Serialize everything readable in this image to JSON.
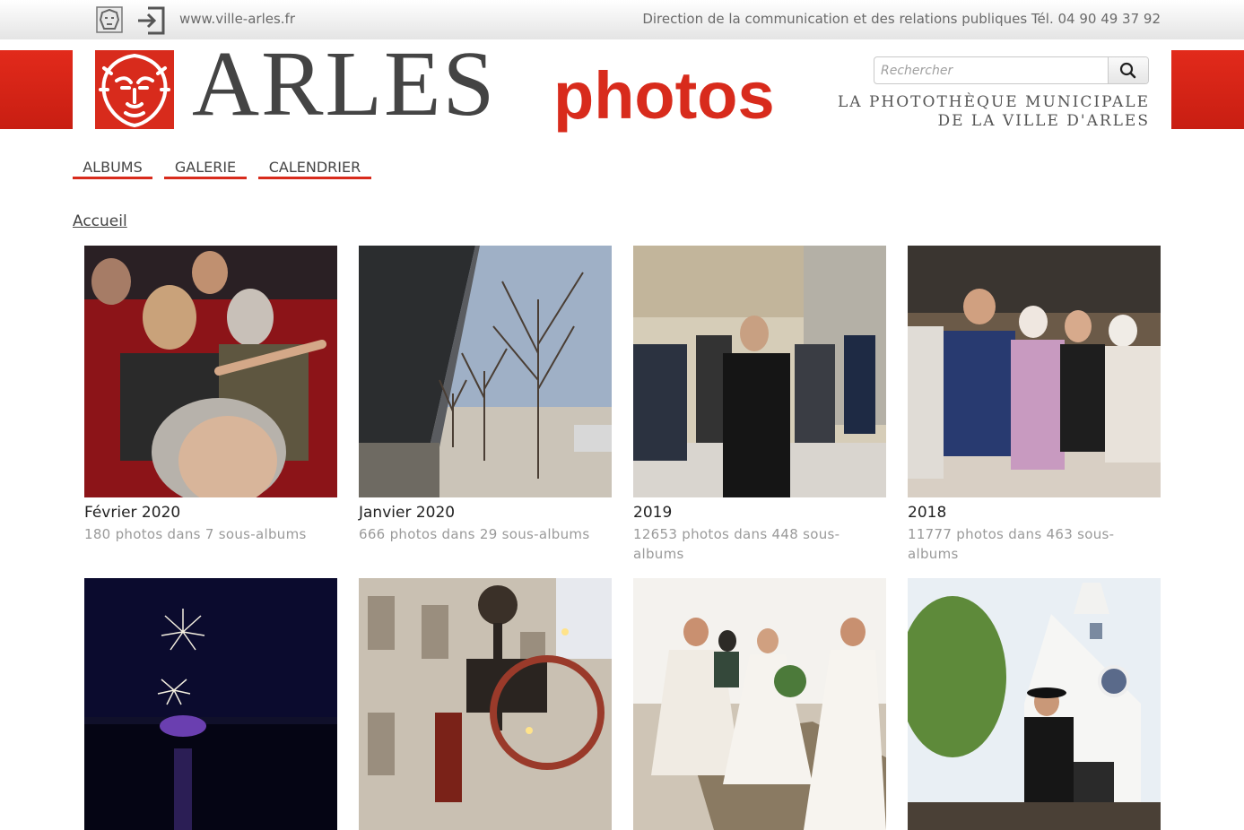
{
  "topbar": {
    "url": "www.ville-arles.fr",
    "contact": "Direction de la communication et des relations publiques Tél. 04 90 49 37 92",
    "icons": [
      "lion-emblem-icon",
      "login-icon"
    ]
  },
  "header": {
    "logo_main": "ARLES",
    "logo_sub": "photos",
    "search_placeholder": "Rechercher",
    "tagline_line1": "LA PHOTOTHÈQUE MUNICIPALE",
    "tagline_line2": "DE LA VILLE D'ARLES"
  },
  "nav": {
    "items": [
      {
        "label": "ALBUMS"
      },
      {
        "label": "GALERIE"
      },
      {
        "label": "CALENDRIER"
      }
    ]
  },
  "breadcrumb": "Accueil",
  "albums": [
    {
      "title": "Février 2020",
      "count": "180 photos dans 7 sous-albums"
    },
    {
      "title": "Janvier 2020",
      "count": "666 photos dans 29 sous-albums"
    },
    {
      "title": "2019",
      "count": "12653 photos dans 448 sous-albums"
    },
    {
      "title": "2018",
      "count": "11777 photos dans 463 sous-albums"
    },
    {
      "title": "",
      "count": ""
    },
    {
      "title": "",
      "count": ""
    },
    {
      "title": "",
      "count": ""
    },
    {
      "title": "",
      "count": ""
    }
  ],
  "colors": {
    "brand_red": "#d82b1c",
    "text_grey": "#6a6a6a"
  }
}
